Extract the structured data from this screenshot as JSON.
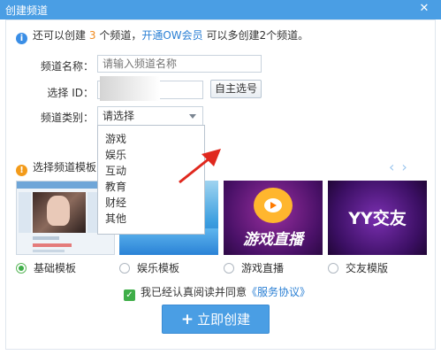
{
  "window": {
    "title": "创建频道",
    "close_glyph": "✕"
  },
  "notice": {
    "prefix": "还可以创建",
    "count": "3",
    "middle": "个频道，",
    "link": "开通OW会员",
    "suffix": "可以多创建2个频道。"
  },
  "form": {
    "name_label": "频道名称：",
    "name_placeholder": "请输入频道名称",
    "id_label": "选择 ID：",
    "id_button": "自主选号",
    "category_label": "频道类别：",
    "category_value": "请选择",
    "category_options": [
      "游戏",
      "娱乐",
      "互动",
      "教育",
      "财经",
      "其他"
    ]
  },
  "templates": {
    "heading": "选择频道模板：",
    "prev_glyph": "‹",
    "next_glyph": "›",
    "items": [
      {
        "label": "基础模板",
        "selected": true
      },
      {
        "label": "娱乐模板",
        "selected": false
      },
      {
        "label": "游戏直播",
        "selected": false,
        "banner": "游戏直播"
      },
      {
        "label": "交友模版",
        "selected": false,
        "banner": "YY交友"
      }
    ]
  },
  "agreement": {
    "text": "我已经认真阅读并同意",
    "link": "《服务协议》",
    "checked": true
  },
  "create_button": {
    "label": "立即创建",
    "icon": "plus-icon"
  },
  "colors": {
    "titlebar": "#4a9ee4",
    "accent": "#3a8ee6",
    "orange": "#f08a1e",
    "green": "#3fae49"
  }
}
